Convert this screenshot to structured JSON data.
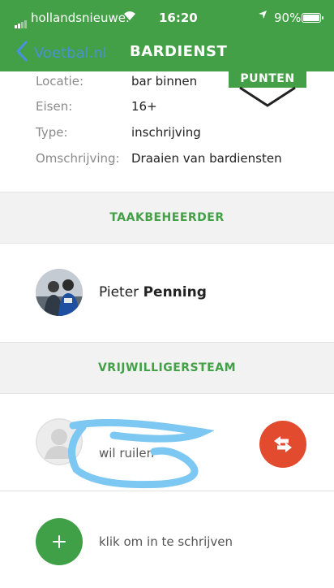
{
  "status_bar": {
    "carrier": "hollandsnieuwe.",
    "time": "16:20",
    "battery": "90%"
  },
  "nav": {
    "back_label": "Voetbal.nl",
    "title": "BARDIENST"
  },
  "badge": {
    "label": "PUNTEN"
  },
  "details": [
    {
      "key": "Locatie:",
      "value": "bar binnen"
    },
    {
      "key": "Eisen:",
      "value": "16+"
    },
    {
      "key": "Type:",
      "value": "inschrijving"
    },
    {
      "key": "Omschrijving:",
      "value": "Draaien van bardiensten"
    }
  ],
  "taakbeheerder": {
    "header": "TAAKBEHEERDER",
    "first_name": "Pieter",
    "last_name": "Penning"
  },
  "vrijwilligersteam": {
    "header": "VRIJWILLIGERSTEAM",
    "swap_text": "wil ruilen",
    "signup_text": "klik om in te schrijven"
  },
  "colors": {
    "brand_green": "#43a047",
    "swap_red": "#e24b2d",
    "scribble_blue": "#7cc8f2"
  }
}
